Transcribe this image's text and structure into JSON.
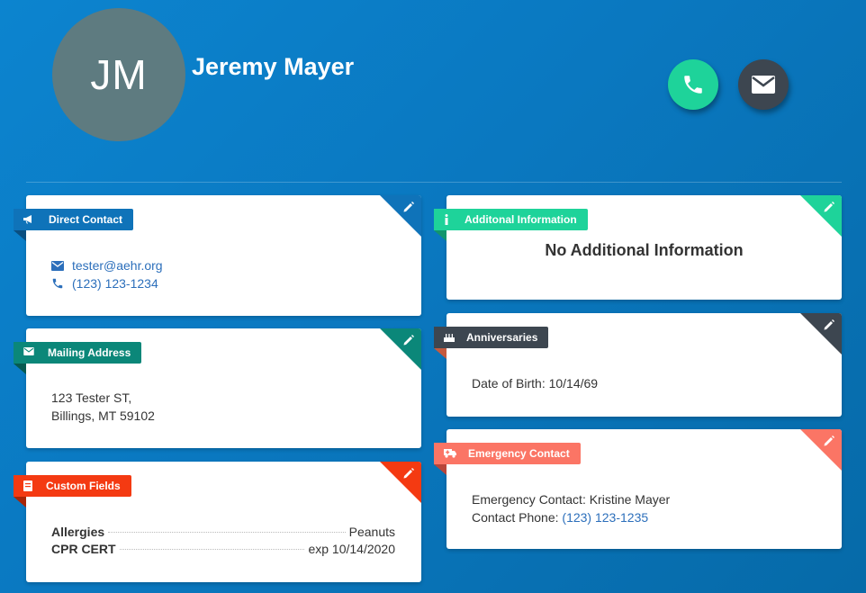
{
  "profile": {
    "initials": "JM",
    "name": "Jeremy Mayer"
  },
  "colors": {
    "direct_contact": "#0f73b9",
    "mailing_address": "#0b8779",
    "custom_fields": "#f43a12",
    "additional_info": "#1ed39a",
    "anniversaries": "#3d4650",
    "emergency": "#fb7565"
  },
  "icons": {
    "phone": "phone-icon",
    "mail": "envelope-icon",
    "edit": "pencil-icon"
  },
  "direct_contact": {
    "title": "Direct Contact",
    "email": "tester@aehr.org",
    "phone": "(123) 123-1234"
  },
  "mailing_address": {
    "title": "Mailing Address",
    "line1": "123 Tester ST,",
    "line2": "Billings, MT 59102"
  },
  "custom_fields": {
    "title": "Custom Fields",
    "rows": [
      {
        "key": "Allergies",
        "value": "Peanuts"
      },
      {
        "key": "CPR CERT",
        "value": "exp 10/14/2020"
      }
    ]
  },
  "additional_info": {
    "title": "Additonal Information",
    "message": "No Additional Information"
  },
  "anniversaries": {
    "title": "Anniversaries",
    "dob": "Date of Birth: 10/14/69"
  },
  "emergency": {
    "title": "Emergency Contact",
    "contact": "Emergency Contact: Kristine Mayer",
    "phone_label": "Contact Phone:",
    "phone": "(123) 123-1235"
  }
}
